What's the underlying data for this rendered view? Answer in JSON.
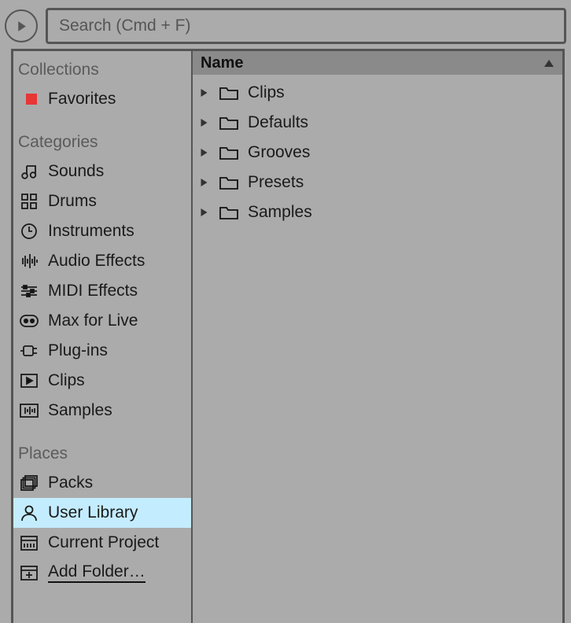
{
  "search": {
    "placeholder": "Search (Cmd + F)"
  },
  "sidebar": {
    "collections_label": "Collections",
    "favorites_label": "Favorites",
    "favorites_color": "#e83535",
    "categories_label": "Categories",
    "categories": [
      {
        "icon": "music-note-icon",
        "label": "Sounds"
      },
      {
        "icon": "grid-icon",
        "label": "Drums"
      },
      {
        "icon": "clock-icon",
        "label": "Instruments"
      },
      {
        "icon": "waveform-icon",
        "label": "Audio Effects"
      },
      {
        "icon": "sliders-icon",
        "label": "MIDI Effects"
      },
      {
        "icon": "max-icon",
        "label": "Max for Live"
      },
      {
        "icon": "plug-icon",
        "label": "Plug-ins"
      },
      {
        "icon": "play-clip-icon",
        "label": "Clips"
      },
      {
        "icon": "samples-wave-icon",
        "label": "Samples"
      }
    ],
    "places_label": "Places",
    "places": [
      {
        "icon": "packs-icon",
        "label": "Packs",
        "selected": false
      },
      {
        "icon": "user-icon",
        "label": "User Library",
        "selected": true
      },
      {
        "icon": "project-icon",
        "label": "Current Project",
        "selected": false
      },
      {
        "icon": "add-folder-icon",
        "label": "Add Folder…",
        "selected": false,
        "underlined": true
      }
    ]
  },
  "content": {
    "column_header": "Name",
    "sort": "asc",
    "items": [
      {
        "label": "Clips"
      },
      {
        "label": "Defaults"
      },
      {
        "label": "Grooves"
      },
      {
        "label": "Presets"
      },
      {
        "label": "Samples"
      }
    ]
  }
}
